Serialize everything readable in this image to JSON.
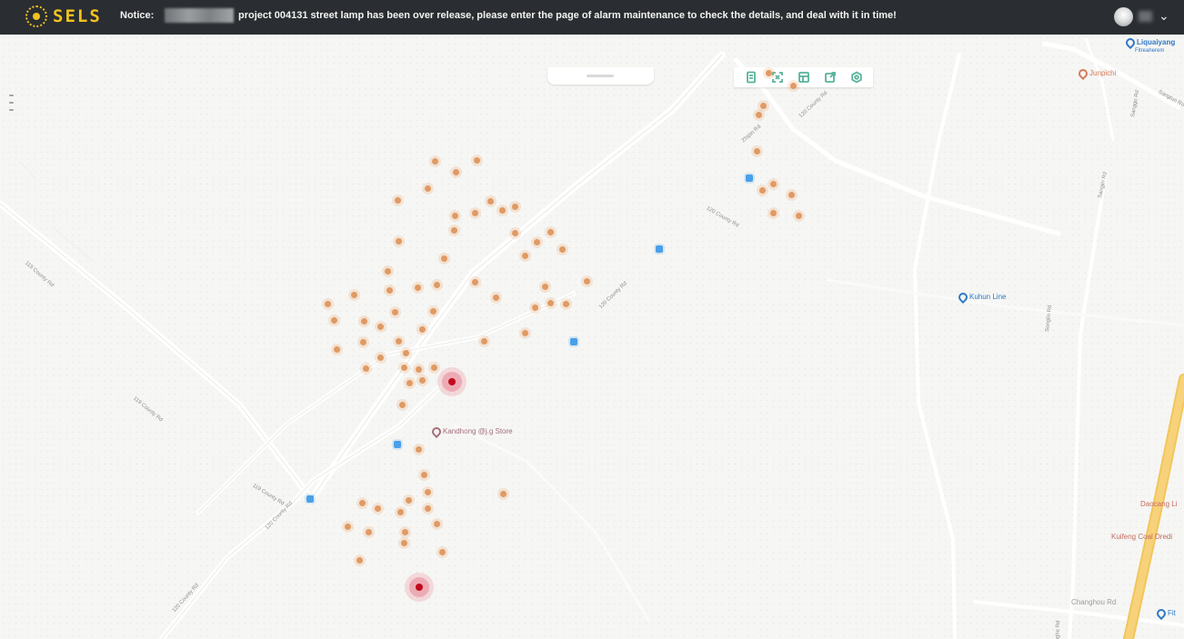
{
  "app": {
    "logo_text": "SELS",
    "notice_label": "Notice:",
    "notice_message": "project 004131 street lamp has been over release, please enter the page of alarm maintenance to check the details, and deal with it in time!"
  },
  "toolbar_icons": [
    "document-icon",
    "fullscreen-icon",
    "grid-icon",
    "export-icon",
    "settings-icon"
  ],
  "map": {
    "poi_store": "Kandhong @j.g Store",
    "poi_kuhun": "Kuhun Line",
    "poi_junpu": "Junpichi",
    "poi_liquaiyang": "Liquaiyang",
    "poi_liquaiyang_sub": "Fitreaherem",
    "poi_daocang": "Daocang Li",
    "poi_kuifeng": "Kuifeng Coal Dredi",
    "poi_changtou": "Changhou Rd",
    "poi_f": "Fit",
    "poi_top_pill": "",
    "road_labels": [
      "119 County Rd",
      "119 County Rd",
      "119 County Rd",
      "120 County Rd",
      "120 County Rd",
      "120 County Rd",
      "120 County Rd",
      "120 County Rd",
      "Zhipin Rd",
      "Sanggo Rd",
      "Sangjin Rd",
      "Songlin Rd",
      "Sangtun Rd",
      "Donghe Rd"
    ]
  },
  "colors": {
    "topbar": "#2a2d31",
    "brand": "#f2c31d",
    "lamp": "#e09a64",
    "alarm": "#c20b1f",
    "toolbar_icon": "#57b39a"
  }
}
